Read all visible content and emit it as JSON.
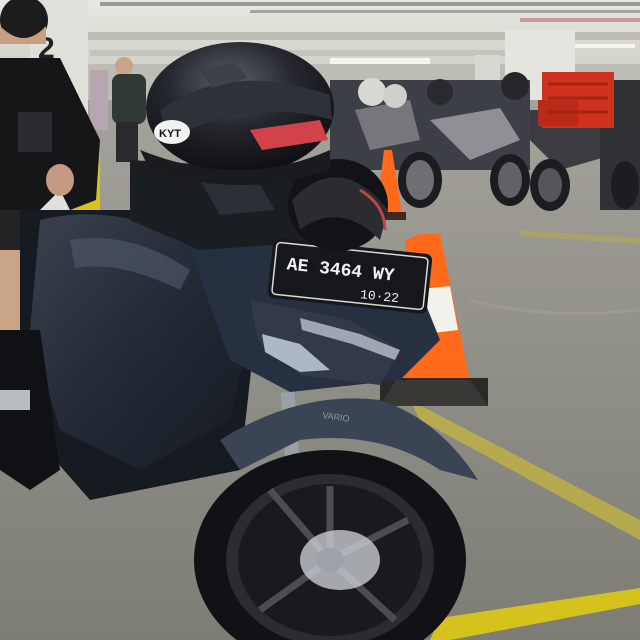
{
  "scene": {
    "pillar_number": "2",
    "helmet_brand": "KYT",
    "plate_number": "AE 3464 WY",
    "plate_expiry": "10·22",
    "fender_badge": "VARIO"
  },
  "colors": {
    "ceiling": "#dcdcd6",
    "floor": "#8d8c85",
    "scooter_body": "#20252d",
    "cone_orange": "#ff6a1a",
    "crate_red": "#d0321f",
    "floor_line_yellow": "#d6c21d"
  }
}
